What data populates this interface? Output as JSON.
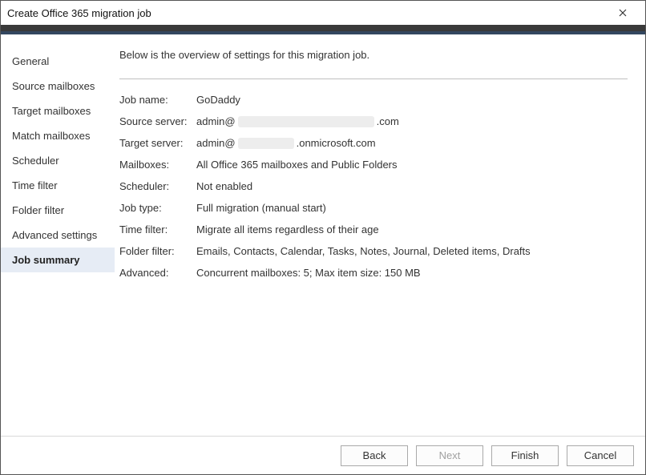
{
  "titlebar": {
    "text": "Create Office 365 migration job"
  },
  "sidebar": {
    "items": [
      {
        "label": "General"
      },
      {
        "label": "Source mailboxes"
      },
      {
        "label": "Target mailboxes"
      },
      {
        "label": "Match mailboxes"
      },
      {
        "label": "Scheduler"
      },
      {
        "label": "Time filter"
      },
      {
        "label": "Folder filter"
      },
      {
        "label": "Advanced settings"
      },
      {
        "label": "Job summary"
      }
    ],
    "active_index": 8
  },
  "content": {
    "intro": "Below is the overview of settings for this migration job.",
    "rows": {
      "job_name": {
        "label": "Job name:",
        "value": "GoDaddy"
      },
      "source_server": {
        "label": "Source server:",
        "prefix": "admin@",
        "suffix": ".com"
      },
      "target_server": {
        "label": "Target server:",
        "prefix": "admin@",
        "suffix": ".onmicrosoft.com"
      },
      "mailboxes": {
        "label": "Mailboxes:",
        "value": "All Office 365 mailboxes and Public Folders"
      },
      "scheduler": {
        "label": "Scheduler:",
        "value": "Not enabled"
      },
      "job_type": {
        "label": "Job type:",
        "value": "Full migration (manual start)"
      },
      "time_filter": {
        "label": "Time filter:",
        "value": "Migrate all items regardless of their age"
      },
      "folder_filter": {
        "label": "Folder filter:",
        "value": "Emails, Contacts, Calendar, Tasks, Notes, Journal, Deleted items, Drafts"
      },
      "advanced": {
        "label": "Advanced:",
        "value": "Concurrent mailboxes: 5; Max item size: 150 MB"
      }
    }
  },
  "footer": {
    "back": "Back",
    "next": "Next",
    "finish": "Finish",
    "cancel": "Cancel"
  }
}
